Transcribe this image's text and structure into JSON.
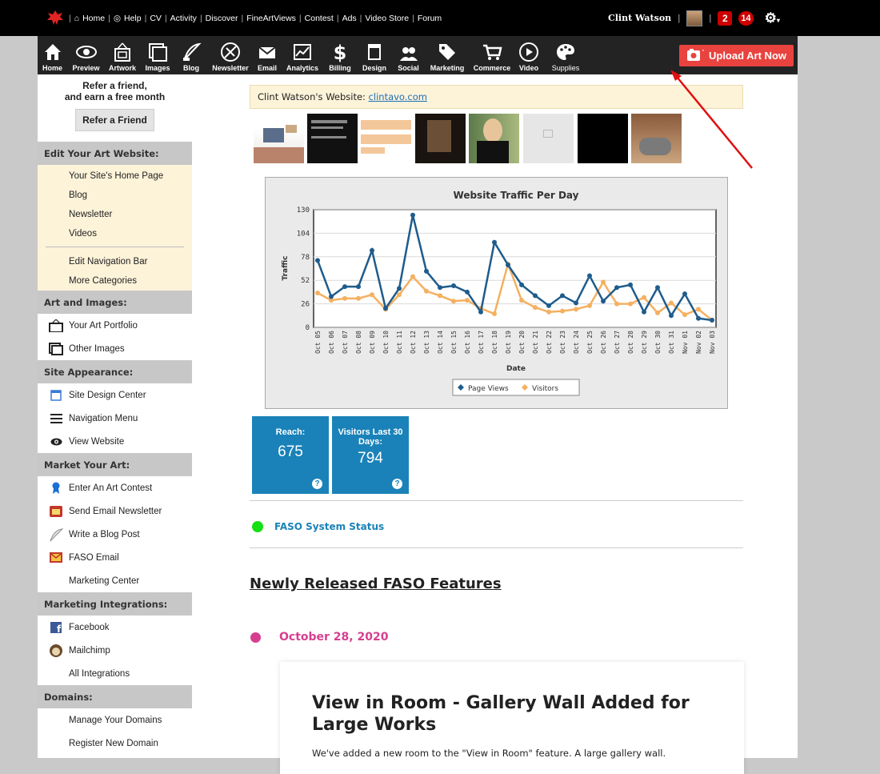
{
  "topbar": {
    "links": [
      "Home",
      "Help",
      "CV",
      "Activity",
      "Discover",
      "FineArtViews",
      "Contest",
      "Ads",
      "Video Store",
      "Forum"
    ],
    "user_name": "Clint Watson",
    "badge_messages": "2",
    "badge_notifications": "14"
  },
  "toolbar": {
    "items": [
      {
        "label": "Home",
        "icon": "home-icon"
      },
      {
        "label": "Preview",
        "icon": "eye-icon"
      },
      {
        "label": "Artwork",
        "icon": "frame-icon"
      },
      {
        "label": "Images",
        "icon": "images-icon"
      },
      {
        "label": "Blog",
        "icon": "quill-icon"
      },
      {
        "label": "Newsletter",
        "icon": "newsletter-icon"
      },
      {
        "label": "Email",
        "icon": "envelope-icon"
      },
      {
        "label": "Analytics",
        "icon": "chart-icon"
      },
      {
        "label": "Billing",
        "icon": "dollar-icon"
      },
      {
        "label": "Design",
        "icon": "design-icon"
      },
      {
        "label": "Social",
        "icon": "social-icon"
      },
      {
        "label": "Marketing",
        "icon": "tag-icon"
      },
      {
        "label": "Commerce",
        "icon": "cart-icon"
      },
      {
        "label": "Video",
        "icon": "play-icon"
      },
      {
        "label": "Supplies",
        "icon": "palette-icon"
      }
    ],
    "upload_label": "Upload Art Now"
  },
  "sidebar": {
    "refer_title_1": "Refer a friend,",
    "refer_title_2": "and earn a free month",
    "refer_button": "Refer a Friend",
    "edit_header": "Edit Your Art Website:",
    "edit_items": [
      "Your Site's Home Page",
      "Blog",
      "Newsletter",
      "Videos"
    ],
    "edit_items2": [
      "Edit Navigation Bar",
      "More Categories"
    ],
    "art_header": "Art and Images:",
    "art_items": [
      "Your Art Portfolio",
      "Other Images"
    ],
    "appearance_header": "Site Appearance:",
    "appearance_items": [
      "Site Design Center",
      "Navigation Menu",
      "View Website"
    ],
    "market_header": "Market Your Art:",
    "market_items": [
      "Enter An Art Contest",
      "Send Email Newsletter",
      "Write a Blog Post",
      "FASO Email",
      "Marketing Center"
    ],
    "integrations_header": "Marketing Integrations:",
    "integrations_items": [
      "Facebook",
      "Mailchimp",
      "All Integrations"
    ],
    "domains_header": "Domains:",
    "domains_items": [
      "Manage Your Domains",
      "Register New Domain"
    ]
  },
  "main": {
    "website_label": "Clint Watson's Website:",
    "website_link": "clintavo.com",
    "reach_label": "Reach:",
    "reach_value": "675",
    "visitors_label": "Visitors Last 30 Days:",
    "visitors_value": "794",
    "status_label": "FASO System Status",
    "features_heading": "Newly Released FASO Features",
    "feature_date": "October 28, 2020",
    "feature_title": "View in Room - Gallery Wall Added for Large Works",
    "feature_text": "We've added a new room to the \"View in Room\" feature.  A large gallery wall."
  },
  "chart_data": {
    "type": "line",
    "title": "Website Traffic Per Day",
    "xlabel": "Date",
    "ylabel": "Traffic",
    "ylim": [
      0,
      130
    ],
    "yticks": [
      0,
      26,
      52,
      78,
      104,
      130
    ],
    "categories": [
      "Oct 05",
      "Oct 06",
      "Oct 07",
      "Oct 08",
      "Oct 09",
      "Oct 10",
      "Oct 11",
      "Oct 12",
      "Oct 13",
      "Oct 14",
      "Oct 15",
      "Oct 16",
      "Oct 17",
      "Oct 18",
      "Oct 19",
      "Oct 20",
      "Oct 21",
      "Oct 22",
      "Oct 23",
      "Oct 24",
      "Oct 25",
      "Oct 26",
      "Oct 27",
      "Oct 28",
      "Oct 29",
      "Oct 30",
      "Oct 31",
      "Nov 01",
      "Nov 02",
      "Nov 03"
    ],
    "series": [
      {
        "name": "Page Views",
        "color": "#1f5c8c",
        "values": [
          74,
          34,
          45,
          45,
          85,
          21,
          43,
          124,
          62,
          44,
          46,
          39,
          17,
          94,
          69,
          47,
          35,
          24,
          35,
          27,
          57,
          29,
          44,
          47,
          17,
          44,
          13,
          37,
          10,
          8
        ]
      },
      {
        "name": "Visitors",
        "color": "#f5b060",
        "values": [
          38,
          30,
          32,
          32,
          36,
          20,
          36,
          56,
          40,
          35,
          29,
          30,
          21,
          15,
          70,
          30,
          22,
          17,
          18,
          20,
          24,
          50,
          26,
          26,
          33,
          16,
          27,
          14,
          20,
          8
        ]
      }
    ],
    "legend_position": "bottom"
  }
}
